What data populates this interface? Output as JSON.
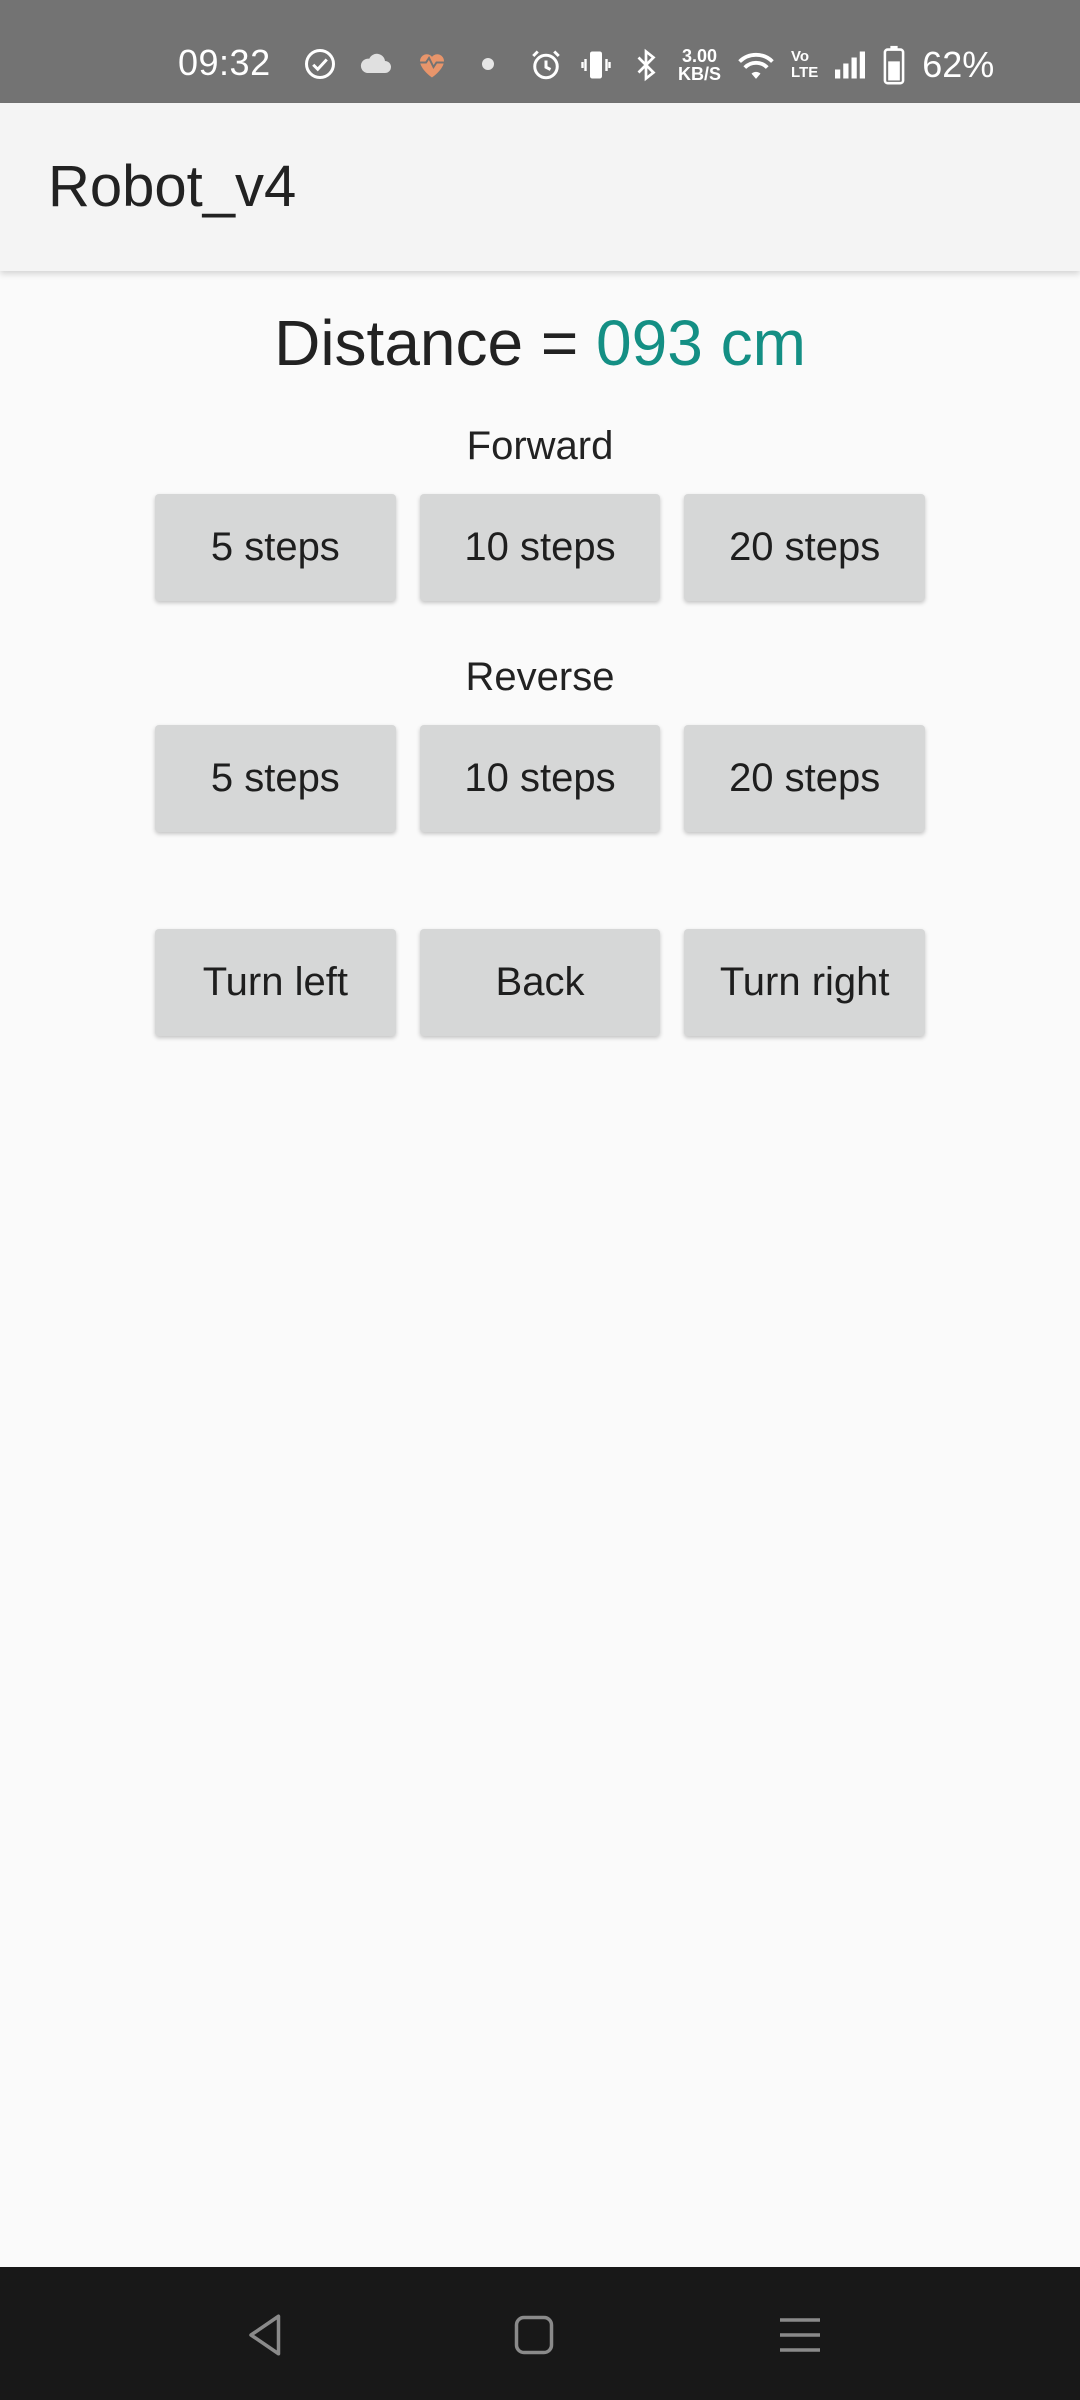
{
  "status_bar": {
    "time": "09:32",
    "net_speed_value": "3.00",
    "net_speed_unit": "KB/S",
    "volte_top": "Vo",
    "volte_bottom": "LTE",
    "battery_percent": "62%",
    "icons": [
      "check-circle-icon",
      "cloud-icon",
      "heart-rate-icon",
      "dot-icon",
      "alarm-icon",
      "vibrate-icon",
      "bluetooth-icon",
      "wifi-icon",
      "signal-icon",
      "battery-icon"
    ],
    "heart_color": "#e8956b"
  },
  "app_bar": {
    "title": "Robot_v4"
  },
  "distance": {
    "label": "Distance = ",
    "value": "093 cm",
    "value_color": "#148f84"
  },
  "forward": {
    "label": "Forward",
    "buttons": [
      "5 steps",
      "10 steps",
      "20 steps"
    ]
  },
  "reverse": {
    "label": "Reverse",
    "buttons": [
      "5 steps",
      "10 steps",
      "20 steps"
    ]
  },
  "turn": {
    "buttons": [
      "Turn left",
      "Back",
      "Turn right"
    ]
  },
  "nav_bar": {
    "icons": [
      "back-icon",
      "home-icon",
      "menu-icon"
    ]
  }
}
